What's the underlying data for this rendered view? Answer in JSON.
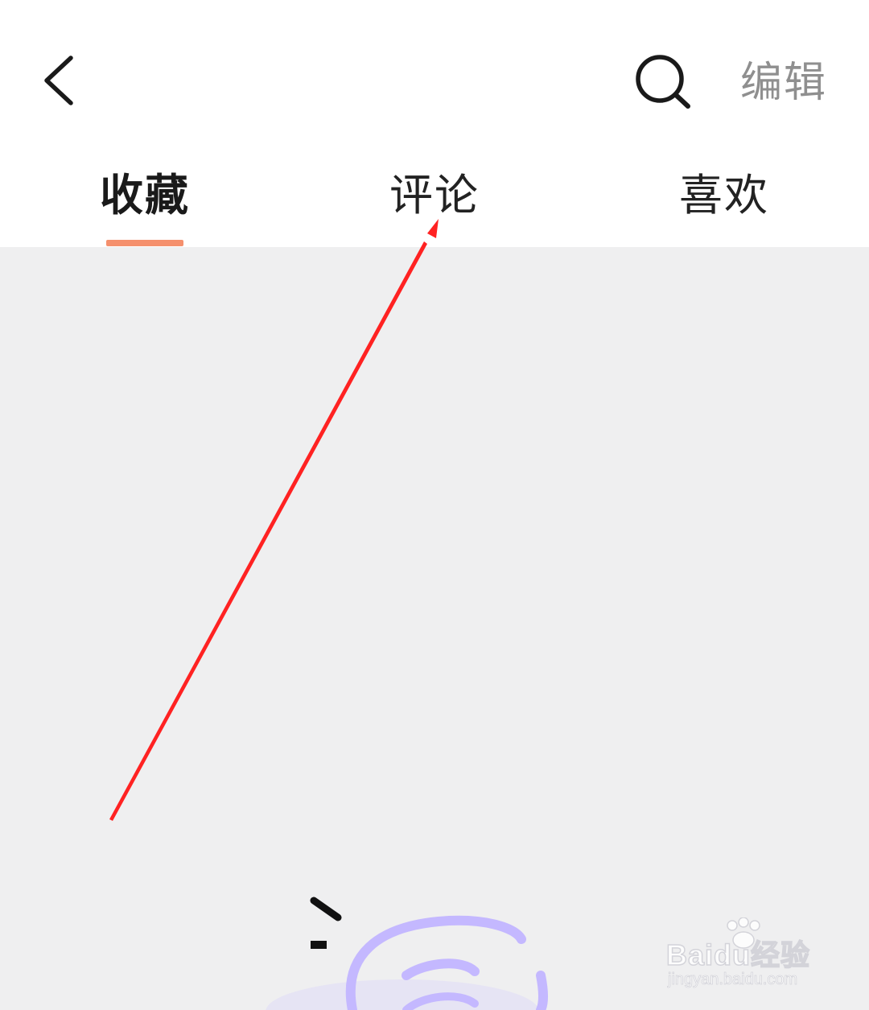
{
  "header": {
    "back_icon": "chevron-left-icon",
    "search_icon": "search-icon",
    "edit_label": "编辑"
  },
  "tabs": [
    {
      "label": "收藏",
      "active": true
    },
    {
      "label": "评论",
      "active": false
    },
    {
      "label": "喜欢",
      "active": false
    }
  ],
  "colors": {
    "tab_indicator": "#f5906d",
    "annotation_arrow": "#ff2222",
    "content_background": "#efeff0",
    "empty_illustration": "#c4b8ff"
  },
  "watermark": {
    "brand": "Baidu经验",
    "url": "jingyan.baidu.com"
  }
}
